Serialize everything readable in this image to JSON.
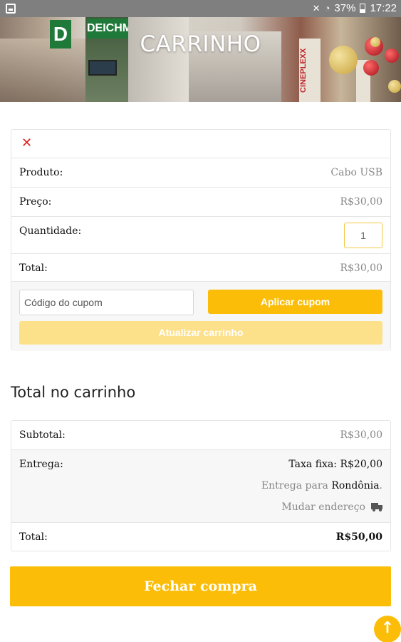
{
  "status_bar": {
    "battery": "37%",
    "time": "17:22"
  },
  "banner": {
    "title": "CARRINHO",
    "store_sign_1": "D",
    "store_sign_2": "DEICHM",
    "cinema_sign": "CINEPLEXX"
  },
  "cart_item": {
    "remove_icon": "close-icon",
    "product_label": "Produto:",
    "product_value": "Cabo USB",
    "price_label": "Preço:",
    "price_value": "R$30,00",
    "quantity_label": "Quantidade:",
    "quantity_value": "1",
    "total_label": "Total:",
    "total_value": "R$30,00"
  },
  "coupon": {
    "placeholder": "Código do cupom",
    "apply_label": "Aplicar cupom",
    "update_label": "Atualizar carrinho"
  },
  "totals": {
    "title": "Total no carrinho",
    "subtotal_label": "Subtotal:",
    "subtotal_value": "R$30,00",
    "shipping_label": "Entrega:",
    "shipping_rate": "Taxa fixa: R$20,00",
    "shipping_to_prefix": "Entrega para",
    "shipping_to_state": "Rondônia",
    "shipping_to_suffix": ".",
    "change_address": "Mudar endereço",
    "total_label": "Total:",
    "total_value": "R$50,00"
  },
  "checkout_label": "Fechar compra",
  "colors": {
    "accent": "#fbbd08",
    "accent_light": "#fde08a",
    "remove": "#e02020",
    "border": "#e6e6e6"
  }
}
